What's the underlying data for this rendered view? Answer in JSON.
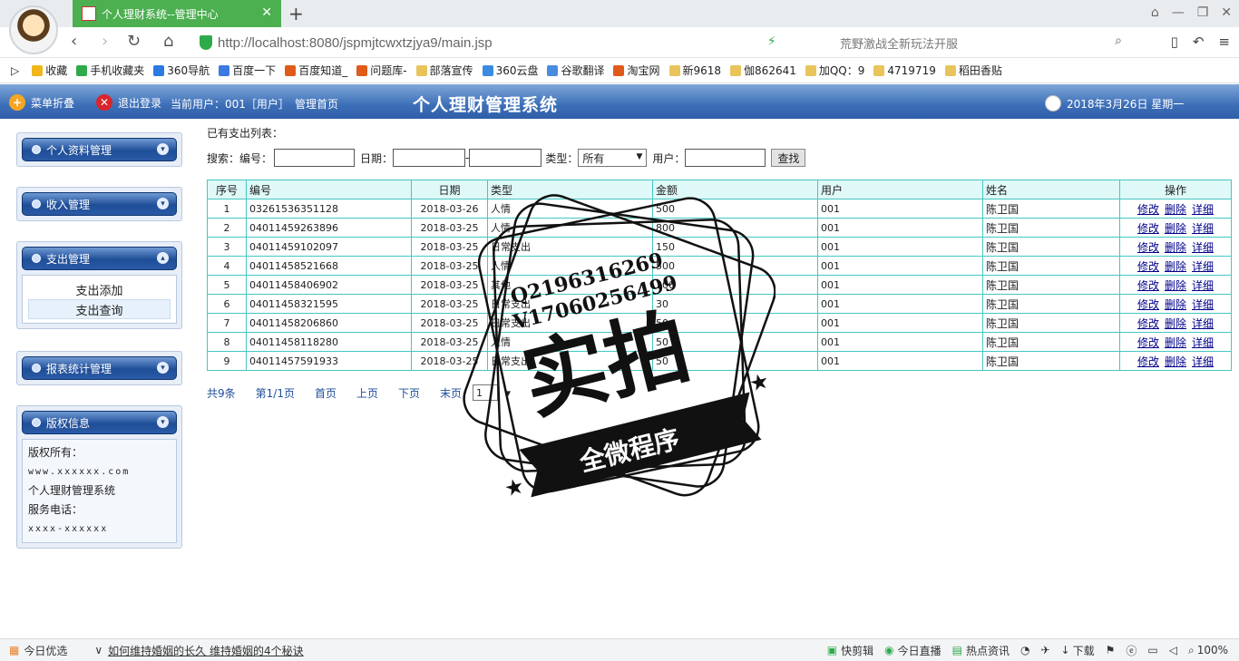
{
  "browser": {
    "tab_title": "个人理财系统--管理中心",
    "url_host": "http://localhost",
    "url_rest": ":8080/jspmjtcwxtzjya9/main.jsp",
    "search_hint": "荒野激战全新玩法开服",
    "bookmarks": [
      "收藏",
      "手机收藏夹",
      "360导航",
      "百度一下",
      "百度知道_",
      "问题库-",
      "部落宣传",
      "360云盘",
      "谷歌翻译",
      "淘宝网",
      "新9618",
      "伽862641",
      "加QQ：9",
      "4719719",
      "稻田香贴"
    ]
  },
  "header": {
    "menu_fold": "菜单折叠",
    "logout": "退出登录",
    "current_user": "当前用户：001［用户］",
    "mgmt_home": "管理首页",
    "title": "个人理财管理系统",
    "date": "2018年3月26日 星期一"
  },
  "sidebar": {
    "personal": "个人资料管理",
    "income": "收入管理",
    "expense": "支出管理",
    "expense_add": "支出添加",
    "expense_query": "支出查询",
    "report": "报表统计管理",
    "copyright": "版权信息",
    "copyright_lines": [
      "版权所有：",
      "www.xxxxxx.com",
      "个人理财管理系统",
      "服务电话：",
      "xxxx-xxxxxx"
    ]
  },
  "main": {
    "list_title": "已有支出列表：",
    "search_label": "搜索：编号：",
    "date_label": "日期：",
    "date_sep": "-",
    "type_label": "类型：",
    "type_value": "所有",
    "user_label": "用户：",
    "search_btn": "查找",
    "columns": [
      "序号",
      "编号",
      "日期",
      "类型",
      "金额",
      "用户",
      "姓名",
      "操作"
    ],
    "ops": [
      "修改",
      "删除",
      "详细"
    ],
    "rows": [
      [
        "1",
        "03261536351128",
        "2018-03-26",
        "人情",
        "500",
        "001",
        "陈卫国"
      ],
      [
        "2",
        "04011459263896",
        "2018-03-25",
        "人情",
        "800",
        "001",
        "陈卫国"
      ],
      [
        "3",
        "04011459102097",
        "2018-03-25",
        "日常支出",
        "150",
        "001",
        "陈卫国"
      ],
      [
        "4",
        "04011458521668",
        "2018-03-25",
        "人情",
        "500",
        "001",
        "陈卫国"
      ],
      [
        "5",
        "04011458406902",
        "2018-03-25",
        "其他",
        "300",
        "001",
        "陈卫国"
      ],
      [
        "6",
        "04011458321595",
        "2018-03-25",
        "日常支出",
        "30",
        "001",
        "陈卫国"
      ],
      [
        "7",
        "04011458206860",
        "2018-03-25",
        "日常支出",
        "50",
        "001",
        "陈卫国"
      ],
      [
        "8",
        "04011458118280",
        "2018-03-25",
        "人情",
        "50",
        "001",
        "陈卫国"
      ],
      [
        "9",
        "04011457591933",
        "2018-03-25",
        "日常支出",
        "50",
        "001",
        "陈卫国"
      ]
    ],
    "pager": {
      "total": "共9条",
      "page": "第1/1页",
      "first": "首页",
      "prev": "上页",
      "next": "下页",
      "last": "末页",
      "select": "1"
    }
  },
  "watermark": {
    "line1": "Q2196316269",
    "line2": "V17060256499",
    "big": "实拍",
    "ribbon": "全微程序"
  },
  "statusbar": {
    "today": "今日优选",
    "news": "如何维持婚姻的长久 维持婚姻的4个秘诀",
    "clip": "快剪辑",
    "live": "今日直播",
    "hot": "热点资讯",
    "download": "下载",
    "zoom": "100%"
  }
}
